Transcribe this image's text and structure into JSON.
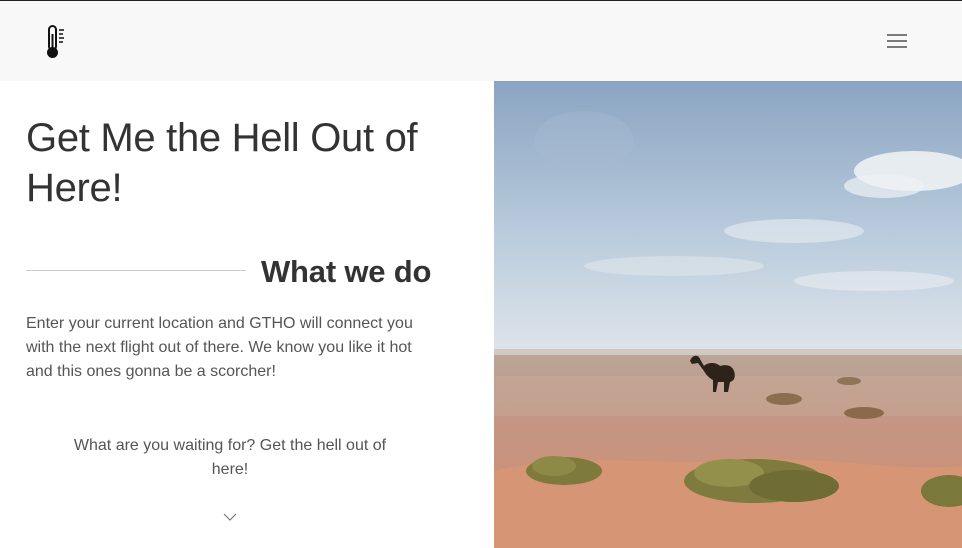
{
  "nav": {
    "logo_icon": "thermometer-icon",
    "menu_icon": "hamburger-menu-icon"
  },
  "hero": {
    "title": "Get Me the Hell Out of Here!",
    "section_title": "What we do",
    "description": "Enter your current location and GTHO will connect you with the next flight out of there. We know you like it hot and this ones gonna be a scorcher!",
    "cta": "What are you waiting for? Get the hell out of here!",
    "scroll_icon": "chevron-down-icon",
    "image": "desert-camel-photo"
  },
  "colors": {
    "navbar_bg": "#f8f8f8",
    "text_dark": "#333333",
    "text_body": "#555555",
    "sky": "#9cb5cf",
    "sand": "#c8917a"
  }
}
